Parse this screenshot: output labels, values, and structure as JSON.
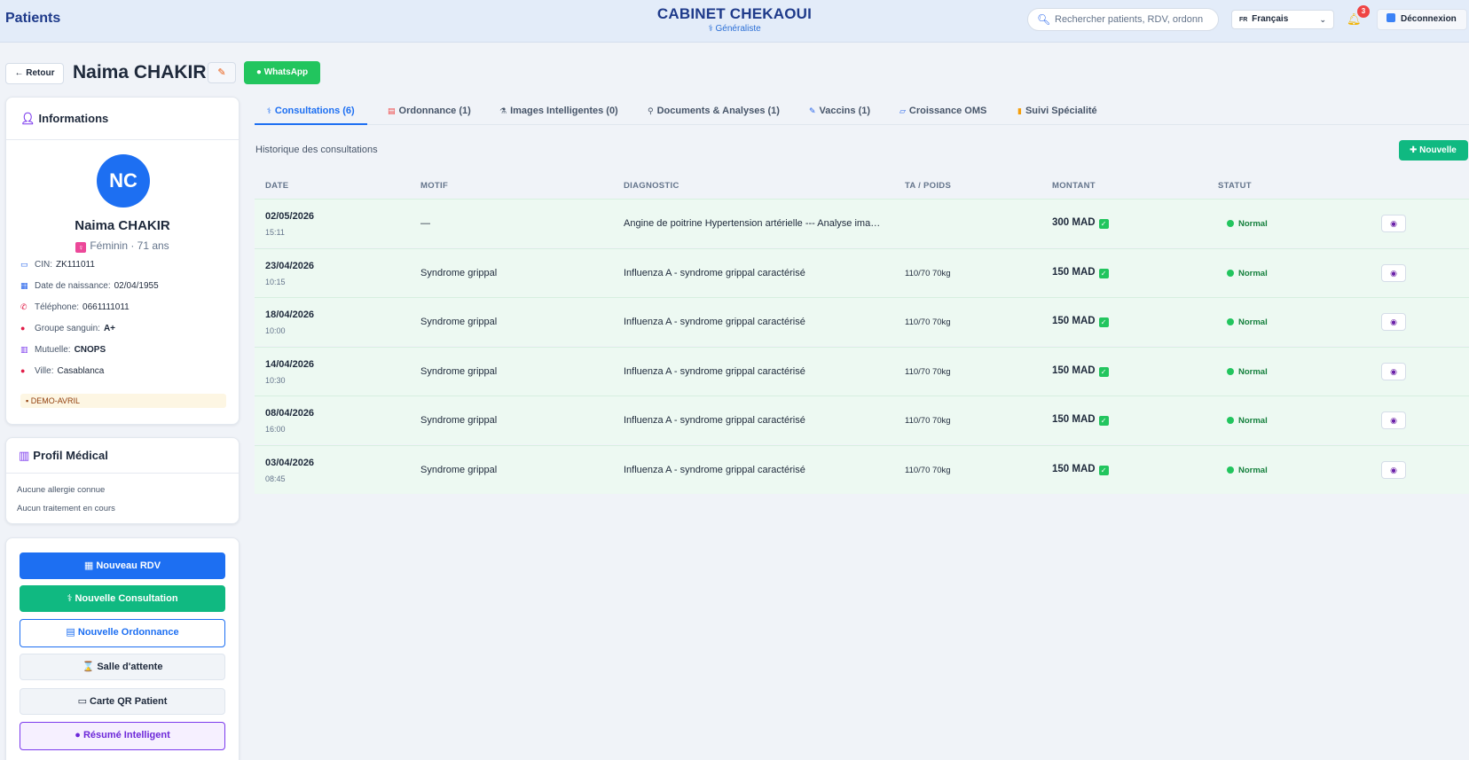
{
  "topbar": {
    "page_title": "Patients",
    "brand": "CABINET CHEKAOUI",
    "specialty": "Généraliste",
    "search_placeholder": "Rechercher patients, RDV, ordonn",
    "language": "Français",
    "language_flag": "FR",
    "notification_count": "3",
    "logout_label": "Déconnexion"
  },
  "header": {
    "back_label": "← Retour",
    "patient_name": "Naima CHAKIR",
    "edit_icon": "pencil-icon",
    "whatsapp_label": "WhatsApp"
  },
  "info_card": {
    "title": "Informations",
    "initials": "NC",
    "name": "Naima CHAKIR",
    "gender_age": "Féminin · 71 ans",
    "fields": [
      {
        "label": "CIN:",
        "value": "ZK111011",
        "icon": "id-card-icon"
      },
      {
        "label": "Date de naissance:",
        "value": "02/04/1955",
        "icon": "calendar-icon"
      },
      {
        "label": "Téléphone:",
        "value": "0661111011",
        "icon": "phone-icon"
      },
      {
        "label": "Groupe sanguin:",
        "value": "A+",
        "icon": "blood-drop-icon"
      },
      {
        "label": "Mutuelle:",
        "value": "CNOPS",
        "icon": "building-icon"
      },
      {
        "label": "Ville:",
        "value": "Casablanca",
        "icon": "pin-icon"
      }
    ],
    "tag": "DEMO-AVRIL"
  },
  "medical_card": {
    "title": "Profil Médical",
    "allergies": "Aucune allergie connue",
    "treatments": "Aucun traitement en cours"
  },
  "actions": {
    "new_rdv": "Nouveau RDV",
    "new_consultation": "Nouvelle Consultation",
    "new_prescription": "Nouvelle Ordonnance",
    "waiting_room": "Salle d'attente",
    "qr_card": "Carte QR Patient",
    "smart_summary": "Résumé Intelligent"
  },
  "tabs": [
    {
      "label": "Consultations (6)",
      "icon": "stethoscope-icon"
    },
    {
      "label": "Ordonnance (1)",
      "icon": "clipboard-icon"
    },
    {
      "label": "Images Intelligentes (0)",
      "icon": "microscope-icon"
    },
    {
      "label": "Documents & Analyses (1)",
      "icon": "test-tube-icon"
    },
    {
      "label": "Vaccins (1)",
      "icon": "syringe-icon"
    },
    {
      "label": "Croissance OMS",
      "icon": "chart-icon"
    },
    {
      "label": "Suivi Spécialité",
      "icon": "bar-chart-icon"
    }
  ],
  "consultations": {
    "history_label": "Historique des consultations",
    "new_label": "Nouvelle",
    "columns": [
      "DATE",
      "MOTIF",
      "DIAGNOSTIC",
      "TA / POIDS",
      "MONTANT",
      "STATUT"
    ],
    "rows": [
      {
        "date": "02/05/2026",
        "time": "15:11",
        "motif": "—",
        "diagnostic": "Angine de poitrine Hypertension artérielle --- Analyse imag...",
        "ta": "",
        "amount": "300 MAD",
        "status": "Normal"
      },
      {
        "date": "23/04/2026",
        "time": "10:15",
        "motif": "Syndrome grippal",
        "diagnostic": "Influenza A - syndrome grippal caractérisé",
        "ta": "110/70 70kg",
        "amount": "150 MAD",
        "status": "Normal"
      },
      {
        "date": "18/04/2026",
        "time": "10:00",
        "motif": "Syndrome grippal",
        "diagnostic": "Influenza A - syndrome grippal caractérisé",
        "ta": "110/70 70kg",
        "amount": "150 MAD",
        "status": "Normal"
      },
      {
        "date": "14/04/2026",
        "time": "10:30",
        "motif": "Syndrome grippal",
        "diagnostic": "Influenza A - syndrome grippal caractérisé",
        "ta": "110/70 70kg",
        "amount": "150 MAD",
        "status": "Normal"
      },
      {
        "date": "08/04/2026",
        "time": "16:00",
        "motif": "Syndrome grippal",
        "diagnostic": "Influenza A - syndrome grippal caractérisé",
        "ta": "110/70 70kg",
        "amount": "150 MAD",
        "status": "Normal"
      },
      {
        "date": "03/04/2026",
        "time": "08:45",
        "motif": "Syndrome grippal",
        "diagnostic": "Influenza A - syndrome grippal caractérisé",
        "ta": "110/70 70kg",
        "amount": "150 MAD",
        "status": "Normal"
      }
    ]
  },
  "colors": {
    "primary": "#1d6ff2",
    "success": "#10b981",
    "whatsapp": "#22c55e",
    "row_bg": "#edf9f2"
  }
}
